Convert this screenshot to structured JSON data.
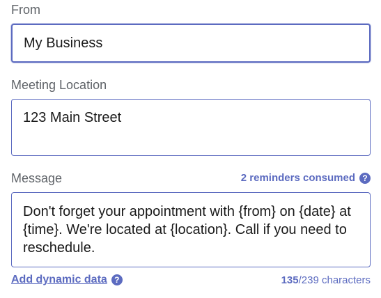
{
  "from": {
    "label": "From",
    "value": "My Business"
  },
  "location": {
    "label": "Meeting Location",
    "value": "123 Main Street"
  },
  "message": {
    "label": "Message",
    "reminders_text": "2 reminders consumed",
    "value": "Don't forget your appointment with {from} on {date} at {time}. We're located at {location}. Call if you need to reschedule."
  },
  "footer": {
    "add_dynamic_label": "Add dynamic data",
    "char_used": "135",
    "char_total": "/239 characters"
  },
  "colors": {
    "accent": "#5c6bc0",
    "label": "#5f6368"
  },
  "icons": {
    "help": "question-mark-icon"
  }
}
